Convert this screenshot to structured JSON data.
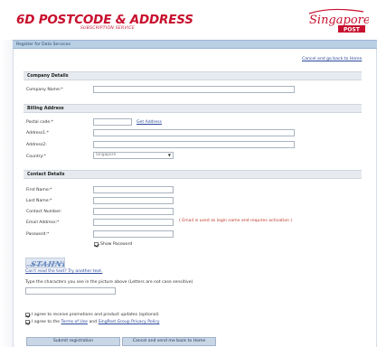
{
  "header": {
    "title": "6D POSTCODE & ADDRESS",
    "subtitle": "SUBSCRIPTION SERVICE",
    "logo_main": "Singapore",
    "logo_sub": "POST"
  },
  "breadcrumb_bar": {
    "text": "Register for Data Services"
  },
  "top_link": "Cancel and go back to Home",
  "company": {
    "section_title": "Company Details",
    "name_label": "Company Name:*",
    "name_value": ""
  },
  "billing": {
    "section_title": "Billing Address",
    "postal_label": "Postal code:*",
    "postal_value": "",
    "get_address": "Get Address",
    "address1_label": "Address1:*",
    "address1_value": "",
    "address2_label": "Address2:",
    "address2_value": "",
    "country_label": "Country:*",
    "country_value": "Singapore"
  },
  "contact": {
    "section_title": "Contact Details",
    "first_name_label": "First Name:*",
    "last_name_label": "Last Name:*",
    "contact_number_label": "Contact Number:",
    "email_label": "Email Address:*",
    "email_note": "( Email is used as login name and requires activation )",
    "password_label": "Password:*",
    "show_password": "Show Password"
  },
  "captcha": {
    "image_text": "STAHNRD",
    "refresh_link": "Can't read the text? Try another text.",
    "instruction": "Type the characters you see in the picture above (Letters are not case sensitive)",
    "value": ""
  },
  "agreements": {
    "promotions": "I agree to receive promotions and product updates (optional)",
    "terms_prefix": "I agree to the",
    "terms_link": "Terms of Use",
    "and": "and",
    "privacy_link": "SingPost Group Privacy Policy"
  },
  "buttons": {
    "submit": "Submit registration",
    "cancel": "Cancel and send me back to Home"
  },
  "colors": {
    "brand_red": "#c8102e",
    "bar_blue": "#b8cfe4",
    "link_blue": "#2d4a9b",
    "note_red": "#c0392b"
  }
}
